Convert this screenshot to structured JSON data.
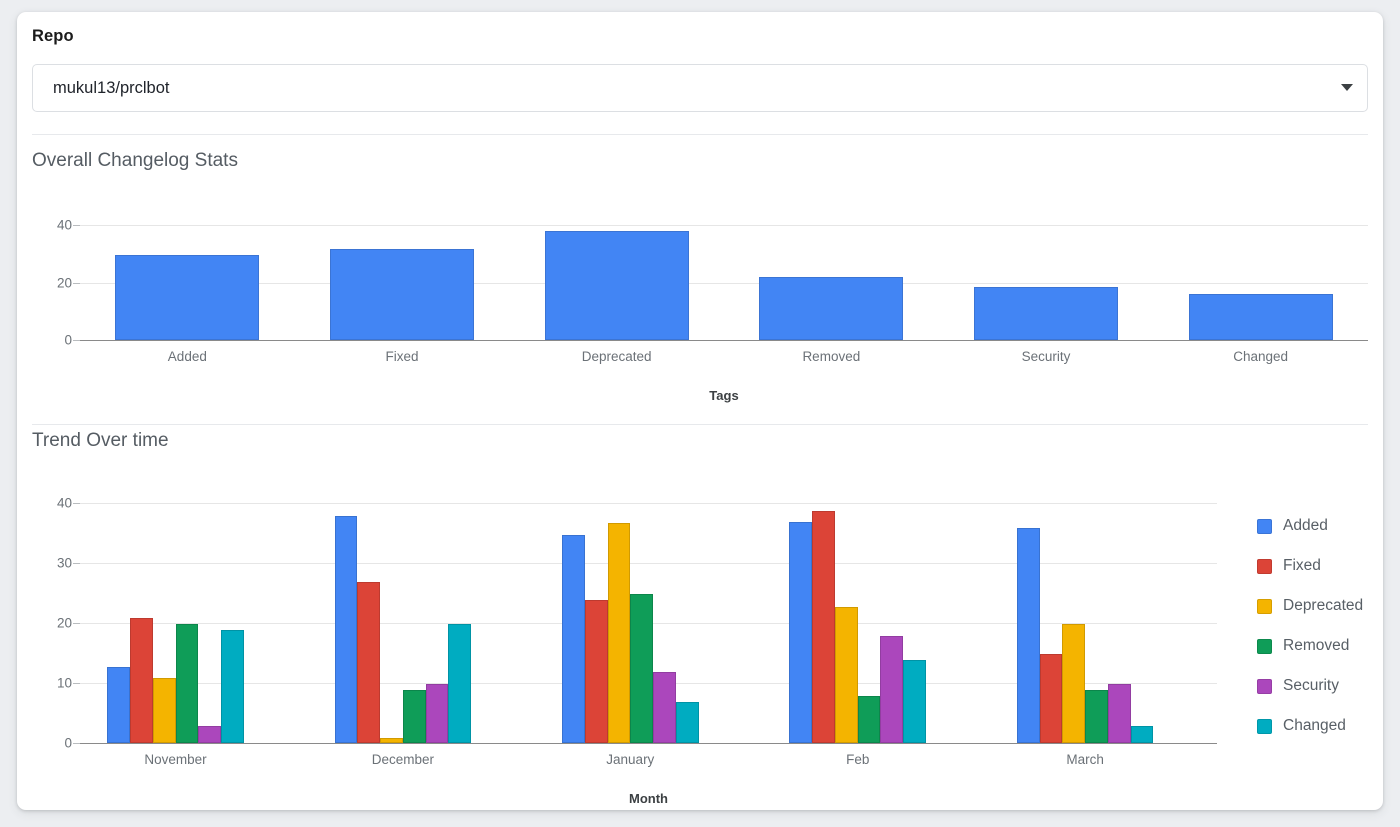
{
  "card": {
    "repo": {
      "label": "Repo",
      "selected": "mukul13/prclbot",
      "arrow_icon": "chevron-down-icon"
    }
  },
  "sections": {
    "overall": {
      "title": "Overall Changelog Stats"
    },
    "trend": {
      "title": "Trend Over time"
    }
  },
  "colors": {
    "added": "#4285f4",
    "fixed": "#dc4437",
    "deprecated": "#f4b400",
    "removed": "#0f9d58",
    "security": "#ab47bc",
    "changed": "#00acc1",
    "bar_primary": "#4285f4",
    "grid": "#e6e6e6",
    "axis": "#8a8a8a",
    "card_bg": "#ffffff",
    "page_bg": "#eceef1"
  },
  "chart_data": [
    {
      "type": "bar",
      "title": "Overall Changelog Stats",
      "categories": [
        "Added",
        "Fixed",
        "Deprecated",
        "Removed",
        "Security",
        "Changed"
      ],
      "values": [
        29.5,
        31.5,
        38,
        22,
        18.5,
        16
      ],
      "xlabel": "Tags",
      "ylabel": "",
      "ylim": [
        0,
        40
      ],
      "yticks": [
        0,
        20,
        40
      ],
      "grid": true,
      "legend": "none",
      "color": "#4285f4"
    },
    {
      "type": "bar",
      "title": "Trend Over time",
      "categories": [
        "November",
        "December",
        "January",
        "Feb",
        "March"
      ],
      "series": [
        {
          "name": "Added",
          "color": "#4285f4",
          "values": [
            12.7,
            37.8,
            34.7,
            36.8,
            35.8
          ]
        },
        {
          "name": "Fixed",
          "color": "#dc4437",
          "values": [
            20.8,
            26.8,
            23.8,
            38.7,
            14.8
          ]
        },
        {
          "name": "Deprecated",
          "color": "#f4b400",
          "values": [
            10.8,
            0.8,
            36.7,
            22.7,
            19.8
          ]
        },
        {
          "name": "Removed",
          "color": "#0f9d58",
          "values": [
            19.8,
            8.8,
            24.8,
            7.8,
            8.8
          ]
        },
        {
          "name": "Security",
          "color": "#ab47bc",
          "values": [
            2.8,
            9.8,
            11.8,
            17.8,
            9.8
          ]
        },
        {
          "name": "Changed",
          "color": "#00acc1",
          "values": [
            18.8,
            19.8,
            6.8,
            13.8,
            2.8
          ]
        }
      ],
      "xlabel": "Month",
      "ylabel": "",
      "ylim": [
        0,
        40
      ],
      "yticks": [
        0,
        10,
        20,
        30,
        40
      ],
      "grid": true,
      "legend": "right"
    }
  ]
}
